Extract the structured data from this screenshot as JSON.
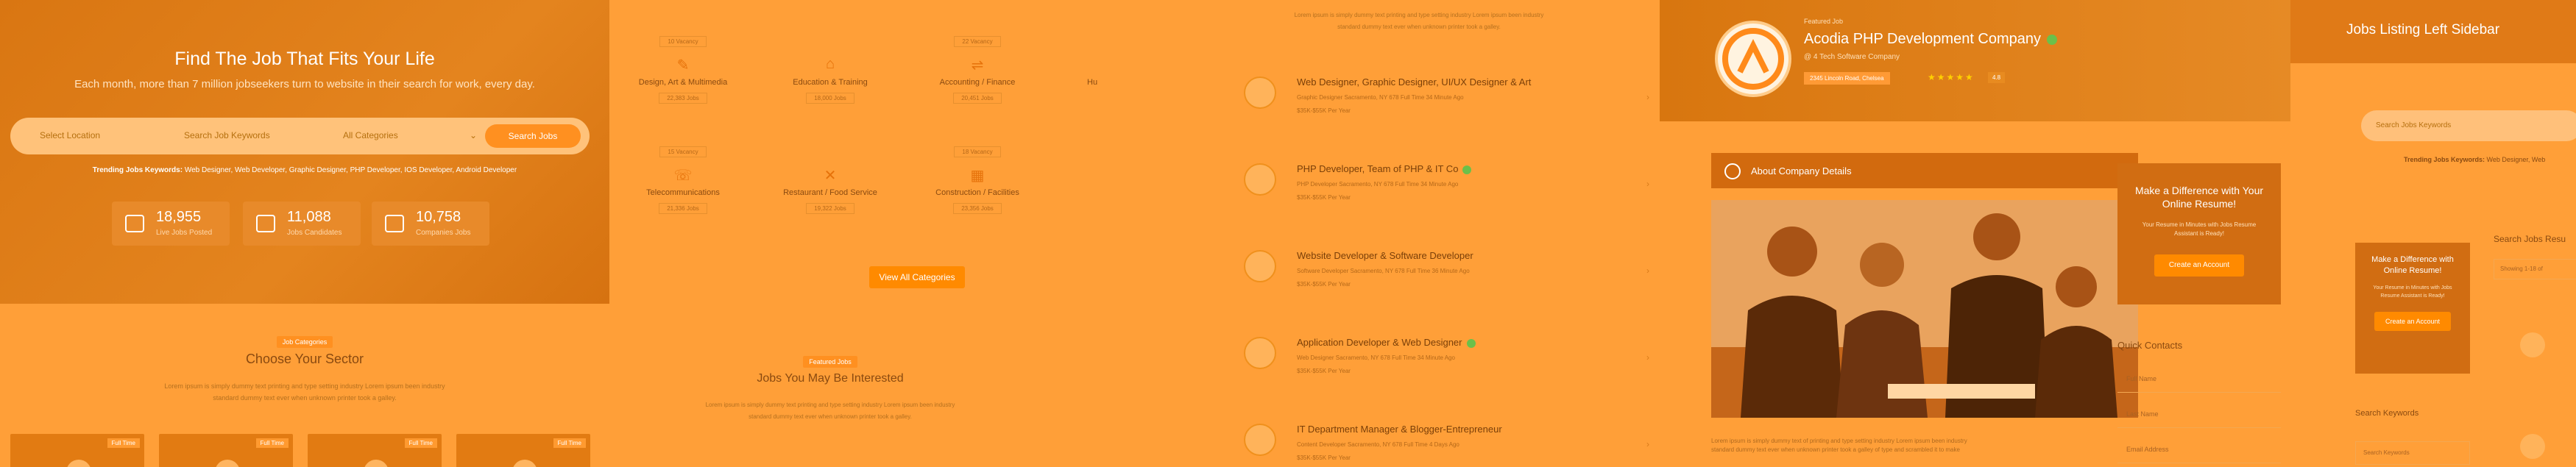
{
  "hero": {
    "title": "Find The Job That Fits Your Life",
    "subtitle": "Each month, more than 7 million jobseekers turn to website in their search for work, every day.",
    "fields": [
      "Select Location",
      "Search Job Keywords",
      "All Categories"
    ],
    "search_btn": "Search Jobs",
    "trending_label": "Trending Jobs Keywords:",
    "trending": "Web Designer, Web Developer, Graphic Designer, PHP Developer, IOS Developer, Android Developer",
    "stats": [
      {
        "num": "18,955",
        "label": "Live Jobs Posted"
      },
      {
        "num": "11,088",
        "label": "Jobs Candidates"
      },
      {
        "num": "10,758",
        "label": "Companies Jobs"
      }
    ]
  },
  "sector": {
    "chip": "Job Categories",
    "title": "Choose Your Sector",
    "text1": "Lorem ipsum is simply dummy text printing and type setting industry Lorem ipsum been industry",
    "text2": "standard dummy text ever when unknown printer took a galley.",
    "cards": [
      "Full Time",
      "Full Time",
      "Full Time",
      "Full Time"
    ]
  },
  "categories": {
    "row1": [
      {
        "top": "10 Vacancy",
        "name": "Design, Art & Multimedia",
        "count": "22,383 Jobs",
        "icon": "pen-icon"
      },
      {
        "top": "",
        "name": "Education & Training",
        "count": "18,000 Jobs",
        "icon": "cap-icon"
      },
      {
        "top": "22 Vacancy",
        "name": "Accounting / Finance",
        "count": "20,451 Jobs",
        "icon": "calc-icon"
      },
      {
        "top": "",
        "name": "Hu",
        "count": "",
        "icon": "user-icon"
      }
    ],
    "row2": [
      {
        "top": "15 Vacancy",
        "name": "Telecommunications",
        "count": "21,336 Jobs",
        "icon": "phone-icon"
      },
      {
        "top": "",
        "name": "Restaurant / Food Service",
        "count": "19,322 Jobs",
        "icon": "fork-icon"
      },
      {
        "top": "18 Vacancy",
        "name": "Construction / Facilities",
        "count": "23,356 Jobs",
        "icon": "building-icon"
      }
    ],
    "btn": "View All Categories",
    "interest_chip": "Featured Jobs",
    "interest_title": "Jobs You May Be Interested",
    "interest_text1": "Lorem ipsum is simply dummy text printing and type setting industry Lorem ipsum been industry",
    "interest_text2": "standard dummy text ever when unknown printer took a galley."
  },
  "jobs": {
    "intro1": "Lorem ipsum is simply dummy text printing and type setting industry Lorem ipsum been industry",
    "intro2": "standard dummy text ever when unknown printer took a galley.",
    "list": [
      {
        "title": "Web Designer, Graphic Designer, UI/UX Designer & Art",
        "m1": "Graphic Designer     Sacramento, NY 678     Full Time     34 Minute Ago",
        "m2": "$35K-$55K Per Year",
        "verified": false
      },
      {
        "title": "PHP Developer, Team of PHP & IT Co",
        "m1": "PHP Developer     Sacramento, NY 678     Full Time     34 Minute Ago",
        "m2": "$35K-$55K Per Year",
        "verified": true
      },
      {
        "title": "Website Developer & Software Developer",
        "m1": "Software Developer     Sacramento, NY 678     Full Time     36 Minute Ago",
        "m2": "$35K-$55K Per Year",
        "verified": false
      },
      {
        "title": "Application Developer & Web Designer",
        "m1": "Web Designer     Sacramento, NY 678     Full Time     34 Minute Ago",
        "m2": "$35K-$55K Per Year",
        "verified": true
      },
      {
        "title": "IT Department Manager & Blogger-Entrepreneur",
        "m1": "Content Developer     Sacramento, NY 678     Full Time     4 Days Ago",
        "m2": "$35K-$55K Per Year",
        "verified": false
      }
    ]
  },
  "company": {
    "pre": "Featured Job",
    "name": "Acodia PHP Development Company",
    "sub": "@ 4 Tech Software Company",
    "addr": "2345 Lincoln Road, Chelsea",
    "stars": "★★★★★",
    "rating": "4.8",
    "about": "About Company Details",
    "ptext1": "Lorem ipsum is simply dummy text of printing and type setting industry Lorem ipsum been industry",
    "ptext2": "standard dummy text ever when unknown printer took a galley of type and scrambled it to make",
    "cta_title": "Make a Difference with Your Online Resume!",
    "cta_text": "Your Resume in Minutes with Jobs Resume Assistant is Ready!",
    "cta_btn": "Create an Account",
    "quick": "Quick Contacts",
    "fields": [
      "Full Name",
      "Last Name",
      "Email Address"
    ]
  },
  "sidebar": {
    "title": "Jobs Listing Left Sidebar",
    "input": "Search Jobs Keywords",
    "trending_label": "Trending Jobs Keywords:",
    "trending": "Web Designer, Web",
    "cta_title": "Make a Difference with Online Resume!",
    "cta_text": "Your Resume in Minutes with Jobs Resume Assistant is Ready!",
    "cta_btn": "Create an Account",
    "search_res": "Search Jobs Resu",
    "showing": "Showing 1-18 of",
    "kw_title": "Search Keywords",
    "kw_input": "Search Keywords"
  }
}
